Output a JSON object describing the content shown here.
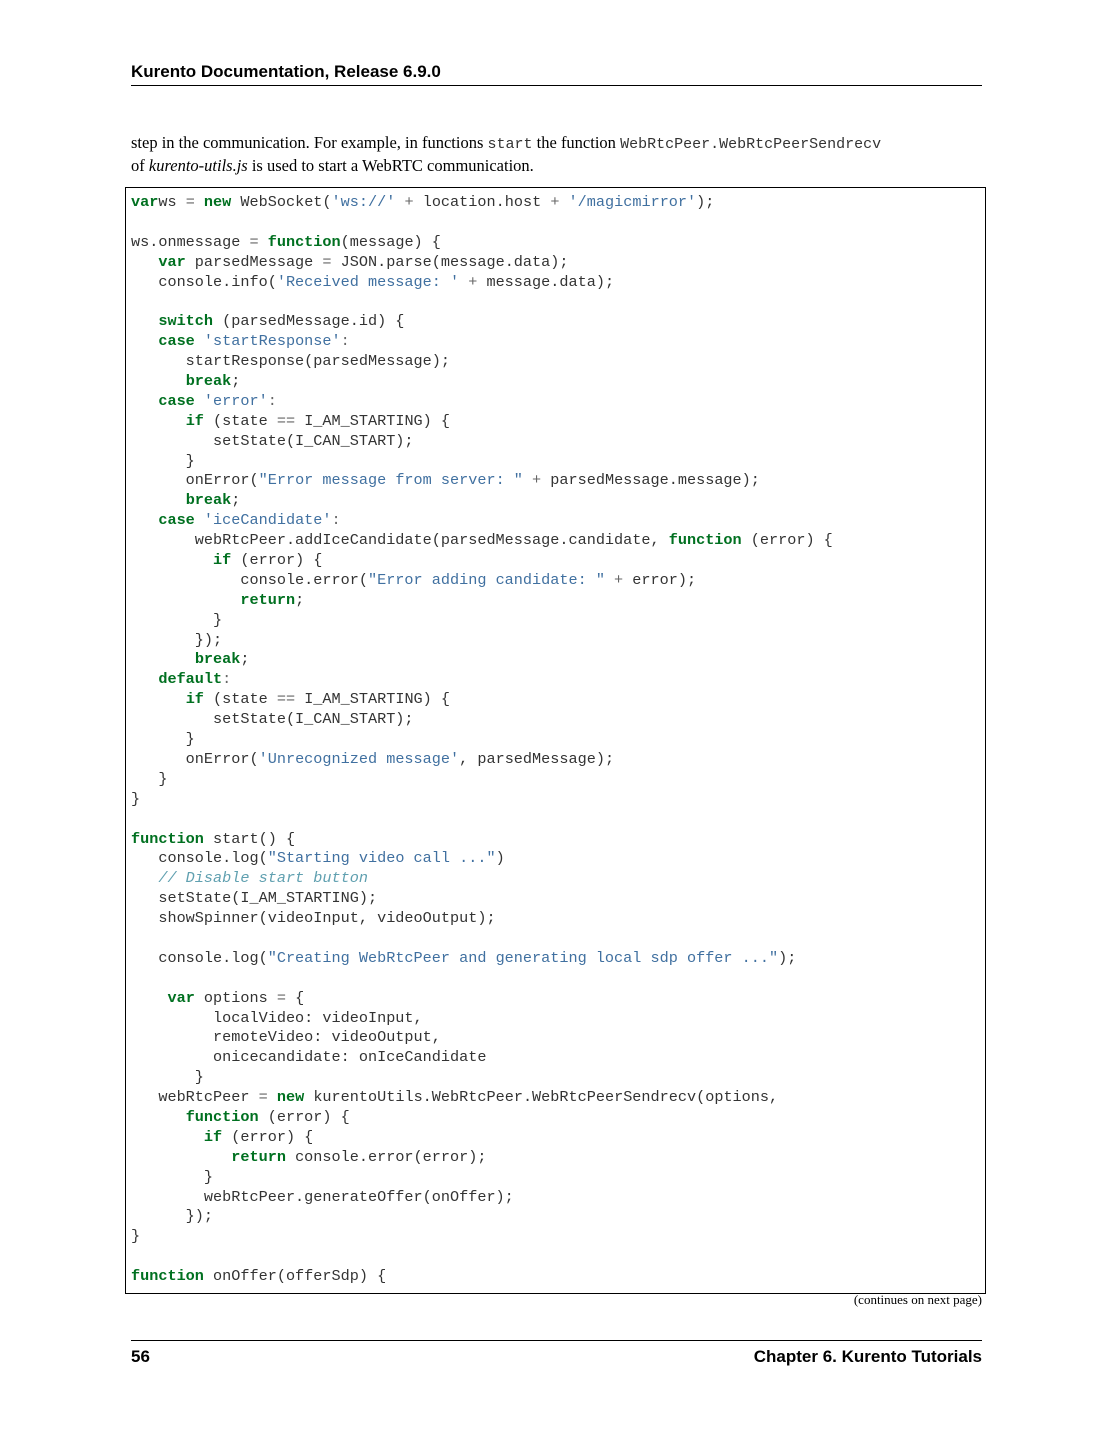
{
  "header": {
    "title": "Kurento Documentation, Release 6.9.0"
  },
  "intro": {
    "t1": "step in the communication. For example, in functions ",
    "c1": "start",
    "t2": " the function ",
    "c2": "WebRtcPeer.WebRtcPeerSendrecv",
    "t3": " of ",
    "e1": "kurento-utils.js",
    "t4": " is used to start a WebRTC communication."
  },
  "code": {
    "lines": [
      [
        [
          "kw",
          "var"
        ],
        [
          "",
          "ws "
        ],
        [
          "op",
          "="
        ],
        [
          "",
          ""
        ],
        [
          "kw",
          " new"
        ],
        [
          "",
          " WebSocket("
        ],
        [
          "str",
          "'ws://'"
        ],
        [
          "op",
          " +"
        ],
        [
          "",
          " location.host "
        ],
        [
          "op",
          "+"
        ],
        [
          "str",
          " '/magicmirror'"
        ],
        [
          "",
          ");"
        ]
      ],
      [],
      [
        [
          "",
          "ws.onmessage "
        ],
        [
          "op",
          "="
        ],
        [
          "kw",
          " function"
        ],
        [
          "",
          "(message) {"
        ]
      ],
      [
        [
          "",
          "   "
        ],
        [
          "kw",
          "var"
        ],
        [
          "",
          " parsedMessage "
        ],
        [
          "op",
          "="
        ],
        [
          "",
          " JSON.parse(message.data);"
        ]
      ],
      [
        [
          "",
          "   console.info("
        ],
        [
          "str",
          "'Received message: '"
        ],
        [
          "op",
          " +"
        ],
        [
          "",
          " message.data);"
        ]
      ],
      [],
      [
        [
          "",
          "   "
        ],
        [
          "kw",
          "switch"
        ],
        [
          "",
          " (parsedMessage.id) {"
        ]
      ],
      [
        [
          "",
          "   "
        ],
        [
          "kw",
          "case"
        ],
        [
          "str",
          " 'startResponse'"
        ],
        [
          "op",
          ":"
        ]
      ],
      [
        [
          "",
          "      startResponse(parsedMessage);"
        ]
      ],
      [
        [
          "",
          "      "
        ],
        [
          "kw",
          "break"
        ],
        [
          "",
          ";"
        ]
      ],
      [
        [
          "",
          "   "
        ],
        [
          "kw",
          "case"
        ],
        [
          "str",
          " 'error'"
        ],
        [
          "op",
          ":"
        ]
      ],
      [
        [
          "",
          "      "
        ],
        [
          "kw",
          "if"
        ],
        [
          "",
          " (state "
        ],
        [
          "op",
          "=="
        ],
        [
          "",
          " I_AM_STARTING) {"
        ]
      ],
      [
        [
          "",
          "         setState(I_CAN_START);"
        ]
      ],
      [
        [
          "",
          "      }"
        ]
      ],
      [
        [
          "",
          "      onError("
        ],
        [
          "str",
          "\"Error message from server: \""
        ],
        [
          "op",
          " +"
        ],
        [
          "",
          " parsedMessage.message);"
        ]
      ],
      [
        [
          "",
          "      "
        ],
        [
          "kw",
          "break"
        ],
        [
          "",
          ";"
        ]
      ],
      [
        [
          "",
          "   "
        ],
        [
          "kw",
          "case"
        ],
        [
          "str",
          " 'iceCandidate'"
        ],
        [
          "op",
          ":"
        ]
      ],
      [
        [
          "",
          "       webRtcPeer.addIceCandidate(parsedMessage.candidate, "
        ],
        [
          "kw",
          "function"
        ],
        [
          "",
          " (error) {"
        ]
      ],
      [
        [
          "",
          "         "
        ],
        [
          "kw",
          "if"
        ],
        [
          "",
          " (error) {"
        ]
      ],
      [
        [
          "",
          "            console.error("
        ],
        [
          "str",
          "\"Error adding candidate: \""
        ],
        [
          "op",
          " +"
        ],
        [
          "",
          " error);"
        ]
      ],
      [
        [
          "",
          "            "
        ],
        [
          "kw",
          "return"
        ],
        [
          "",
          ";"
        ]
      ],
      [
        [
          "",
          "         }"
        ]
      ],
      [
        [
          "",
          "       });"
        ]
      ],
      [
        [
          "",
          "       "
        ],
        [
          "kw",
          "break"
        ],
        [
          "",
          ";"
        ]
      ],
      [
        [
          "",
          "   "
        ],
        [
          "kw",
          "default"
        ],
        [
          "op",
          ":"
        ]
      ],
      [
        [
          "",
          "      "
        ],
        [
          "kw",
          "if"
        ],
        [
          "",
          " (state "
        ],
        [
          "op",
          "=="
        ],
        [
          "",
          " I_AM_STARTING) {"
        ]
      ],
      [
        [
          "",
          "         setState(I_CAN_START);"
        ]
      ],
      [
        [
          "",
          "      }"
        ]
      ],
      [
        [
          "",
          "      onError("
        ],
        [
          "str",
          "'Unrecognized message'"
        ],
        [
          "",
          ", parsedMessage);"
        ]
      ],
      [
        [
          "",
          "   }"
        ]
      ],
      [
        [
          "",
          "}"
        ]
      ],
      [],
      [
        [
          "kw",
          "function"
        ],
        [
          "",
          " start() {"
        ]
      ],
      [
        [
          "",
          "   console.log("
        ],
        [
          "str",
          "\"Starting video call ...\""
        ],
        [
          "",
          ")"
        ]
      ],
      [
        [
          "",
          "   "
        ],
        [
          "com",
          "// Disable start button"
        ]
      ],
      [
        [
          "",
          "   setState(I_AM_STARTING);"
        ]
      ],
      [
        [
          "",
          "   showSpinner(videoInput, videoOutput);"
        ]
      ],
      [],
      [
        [
          "",
          "   console.log("
        ],
        [
          "str",
          "\"Creating WebRtcPeer and generating local sdp offer ...\""
        ],
        [
          "",
          ");"
        ]
      ],
      [],
      [
        [
          "",
          "    "
        ],
        [
          "kw",
          "var"
        ],
        [
          "",
          " options "
        ],
        [
          "op",
          "="
        ],
        [
          "",
          " {"
        ]
      ],
      [
        [
          "",
          "         localVideo: videoInput,"
        ]
      ],
      [
        [
          "",
          "         remoteVideo: videoOutput,"
        ]
      ],
      [
        [
          "",
          "         onicecandidate: onIceCandidate"
        ]
      ],
      [
        [
          "",
          "       }"
        ]
      ],
      [
        [
          "",
          "   webRtcPeer "
        ],
        [
          "op",
          "="
        ],
        [
          "kw",
          " new"
        ],
        [
          "",
          " kurentoUtils.WebRtcPeer.WebRtcPeerSendrecv(options,"
        ]
      ],
      [
        [
          "",
          "      "
        ],
        [
          "kw",
          "function"
        ],
        [
          "",
          " (error) {"
        ]
      ],
      [
        [
          "",
          "        "
        ],
        [
          "kw",
          "if"
        ],
        [
          "",
          " (error) {"
        ]
      ],
      [
        [
          "",
          "           "
        ],
        [
          "kw",
          "return"
        ],
        [
          "",
          " console.error(error);"
        ]
      ],
      [
        [
          "",
          "        }"
        ]
      ],
      [
        [
          "",
          "        webRtcPeer.generateOffer(onOffer);"
        ]
      ],
      [
        [
          "",
          "      });"
        ]
      ],
      [
        [
          "",
          "}"
        ]
      ],
      [],
      [
        [
          "kw",
          "function"
        ],
        [
          "",
          " onOffer(offerSdp) {"
        ]
      ]
    ]
  },
  "continues": "(continues on next page)",
  "footer": {
    "page": "56",
    "chapter": "Chapter 6.  Kurento Tutorials"
  }
}
